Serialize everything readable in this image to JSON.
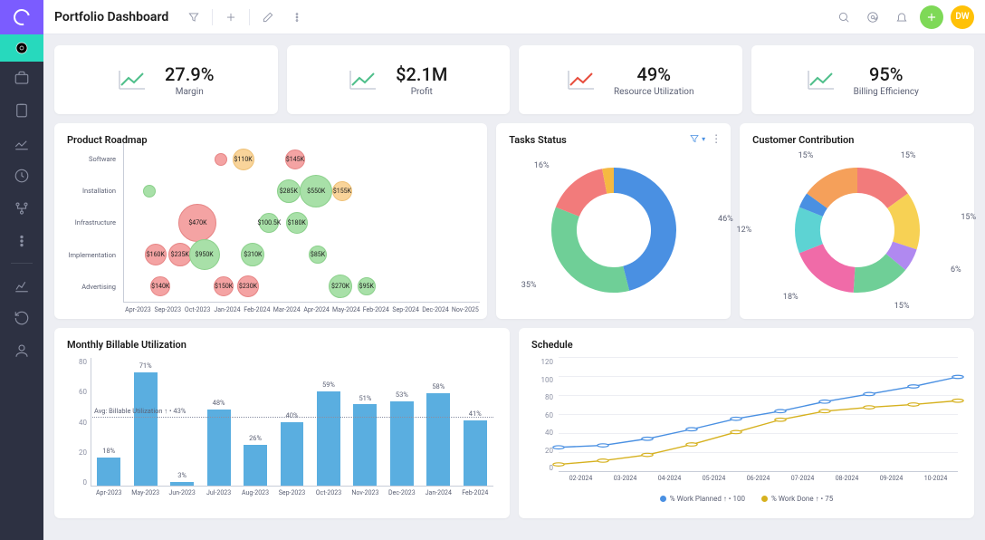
{
  "header": {
    "title": "Portfolio Dashboard",
    "avatar_initials": "DW"
  },
  "kpis": [
    {
      "value": "27.9%",
      "label": "Margin",
      "color": "#4fbf8b"
    },
    {
      "value": "$2.1M",
      "label": "Profit",
      "color": "#4fbf8b"
    },
    {
      "value": "49%",
      "label": "Resource Utilization",
      "color": "#e74c3c"
    },
    {
      "value": "95%",
      "label": "Billing Efficiency",
      "color": "#4fbf8b"
    }
  ],
  "roadmap": {
    "title": "Product Roadmap",
    "y_categories": [
      "Software",
      "Installation",
      "Infrastructure",
      "Implementation",
      "Advertising"
    ],
    "x_categories": [
      "Apr-2023",
      "Sep-2023",
      "Oct-2023",
      "Jan-2024",
      "Feb-2024",
      "Mar-2024",
      "Apr-2024",
      "May-2024",
      "Feb-2024",
      "Sep-2024",
      "Dec-2024",
      "Nov-2025"
    ]
  },
  "chart_data": [
    {
      "type": "bubble",
      "id": "roadmap",
      "y_categories": [
        "Software",
        "Installation",
        "Infrastructure",
        "Implementation",
        "Advertising"
      ],
      "x_range": [
        "Apr-2023",
        "Nov-2025"
      ],
      "bubbles": [
        {
          "label": "",
          "x": 3.0,
          "y": 0,
          "size": 14,
          "cls": "bub-red"
        },
        {
          "label": "$110K",
          "x": 3.7,
          "y": 0,
          "size": 24,
          "cls": "bub-orange"
        },
        {
          "label": "$145K",
          "x": 5.3,
          "y": 0,
          "size": 22,
          "cls": "bub-red"
        },
        {
          "label": "",
          "x": 0.8,
          "y": 1,
          "size": 14,
          "cls": "bub-green"
        },
        {
          "label": "$285K",
          "x": 5.1,
          "y": 1,
          "size": 26,
          "cls": "bub-green"
        },
        {
          "label": "$550K",
          "x": 5.95,
          "y": 1,
          "size": 36,
          "cls": "bub-green"
        },
        {
          "label": "$155K",
          "x": 6.75,
          "y": 1,
          "size": 22,
          "cls": "bub-orange"
        },
        {
          "label": "$470K",
          "x": 2.3,
          "y": 2,
          "size": 42,
          "cls": "bub-red"
        },
        {
          "label": "$100.5K",
          "x": 4.5,
          "y": 2,
          "size": 22,
          "cls": "bub-green"
        },
        {
          "label": "$180K",
          "x": 5.35,
          "y": 2,
          "size": 24,
          "cls": "bub-green"
        },
        {
          "label": "$160K",
          "x": 1.0,
          "y": 3,
          "size": 24,
          "cls": "bub-red"
        },
        {
          "label": "$235K",
          "x": 1.75,
          "y": 3,
          "size": 26,
          "cls": "bub-red"
        },
        {
          "label": "$950K",
          "x": 2.5,
          "y": 3,
          "size": 34,
          "cls": "bub-green"
        },
        {
          "label": "$310K",
          "x": 4.0,
          "y": 3,
          "size": 26,
          "cls": "bub-green"
        },
        {
          "label": "$85K",
          "x": 6.0,
          "y": 3,
          "size": 20,
          "cls": "bub-green"
        },
        {
          "label": "$140K",
          "x": 1.15,
          "y": 4,
          "size": 22,
          "cls": "bub-red"
        },
        {
          "label": "$150K",
          "x": 3.1,
          "y": 4,
          "size": 22,
          "cls": "bub-red"
        },
        {
          "label": "$230K",
          "x": 3.85,
          "y": 4,
          "size": 24,
          "cls": "bub-red"
        },
        {
          "label": "$270K",
          "x": 6.7,
          "y": 4,
          "size": 26,
          "cls": "bub-green"
        },
        {
          "label": "$95K",
          "x": 7.5,
          "y": 4,
          "size": 20,
          "cls": "bub-green"
        }
      ]
    },
    {
      "type": "pie",
      "id": "tasks_status",
      "title": "Tasks Status",
      "slices": [
        {
          "label": "46%",
          "value": 46,
          "color": "#4a90e2"
        },
        {
          "label": "35%",
          "value": 35,
          "color": "#6fcf97"
        },
        {
          "label": "16%",
          "value": 16,
          "color": "#f27b7b"
        },
        {
          "label": "",
          "value": 3,
          "color": "#f5b942"
        }
      ]
    },
    {
      "type": "pie",
      "id": "customer_contribution",
      "title": "Customer Contribution",
      "slices": [
        {
          "label": "15%",
          "value": 15,
          "color": "#f27b7b"
        },
        {
          "label": "15%",
          "value": 15,
          "color": "#f7d154"
        },
        {
          "label": "6%",
          "value": 6,
          "color": "#b089f0"
        },
        {
          "label": "15%",
          "value": 15,
          "color": "#6fcf97"
        },
        {
          "label": "18%",
          "value": 18,
          "color": "#f06ba8"
        },
        {
          "label": "12%",
          "value": 12,
          "color": "#5dd3d3"
        },
        {
          "label": "",
          "value": 4,
          "color": "#4a90e2"
        },
        {
          "label": "15%",
          "value": 15,
          "color": "#f5a05a"
        }
      ]
    },
    {
      "type": "bar",
      "id": "monthly_billable",
      "title": "Monthly Billable Utilization",
      "categories": [
        "Apr-2023",
        "May-2023",
        "Jun-2023",
        "Jul-2023",
        "Aug-2023",
        "Sep-2023",
        "Oct-2023",
        "Nov-2023",
        "Dec-2023",
        "Jan-2024",
        "Feb-2024"
      ],
      "values": [
        18,
        71,
        3,
        48,
        26,
        40,
        59,
        51,
        53,
        58,
        41
      ],
      "ylim": [
        0,
        80
      ],
      "avg_label": "Avg: Billable Utilization ↑ • 43%",
      "avg_value": 43
    },
    {
      "type": "line",
      "id": "schedule",
      "title": "Schedule",
      "x": [
        "02-2024",
        "03-2024",
        "04-2024",
        "05-2024",
        "06-2024",
        "07-2024",
        "08-2024",
        "09-2024",
        "10-2024"
      ],
      "series": [
        {
          "name": "% Work Planned ↑ • 100",
          "color": "#4a90e2",
          "values": [
            26,
            28,
            35,
            45,
            56,
            64,
            74,
            82,
            90,
            100
          ]
        },
        {
          "name": "% Work Done ↑ • 75",
          "color": "#d6b11f",
          "values": [
            8,
            12,
            18,
            29,
            42,
            55,
            64,
            68,
            71,
            75
          ]
        }
      ],
      "ylim": [
        0,
        120
      ]
    }
  ]
}
